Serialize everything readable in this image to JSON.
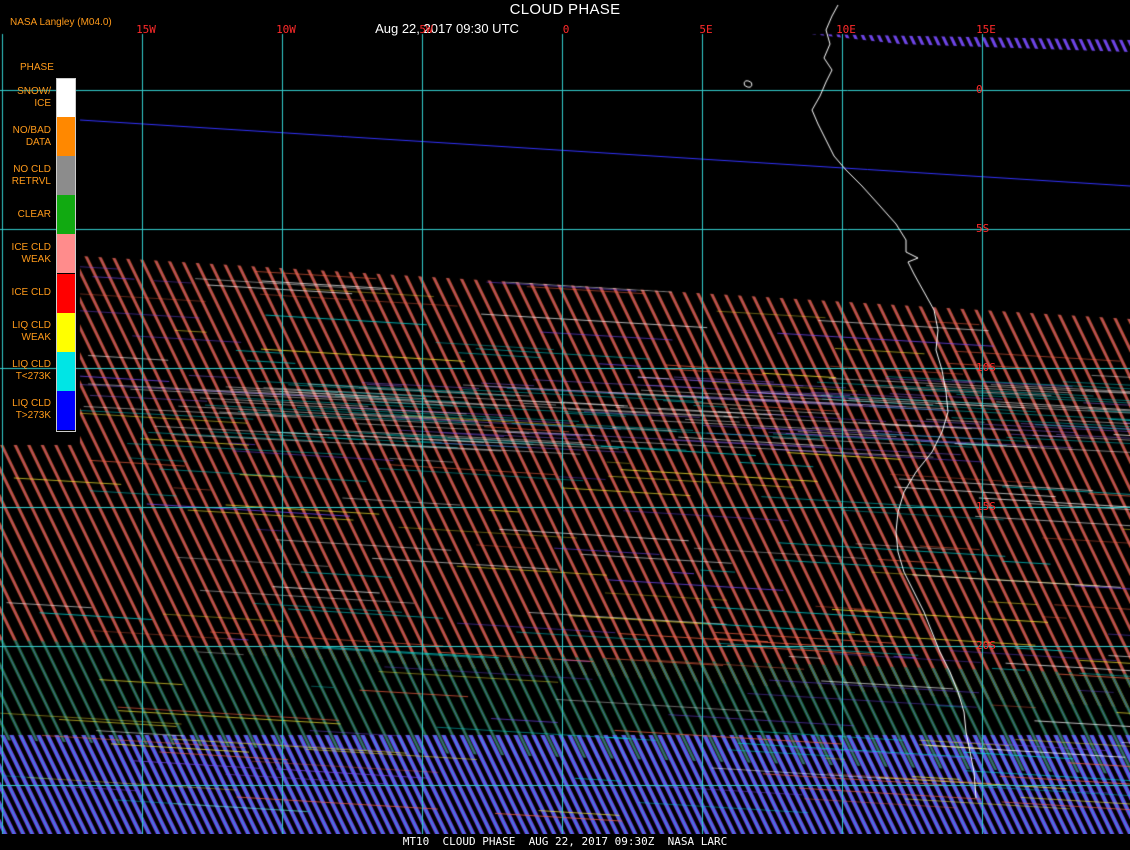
{
  "header": {
    "title": "CLOUD PHASE",
    "datetime": "Aug 22, 2017 09:30 UTC",
    "credit": "NASA Langley (M04.0)"
  },
  "grid": {
    "longitude_labels": [
      {
        "text": "15W",
        "lon": -15
      },
      {
        "text": "10W",
        "lon": -10
      },
      {
        "text": "5W",
        "lon": -5
      },
      {
        "text": "0",
        "lon": 0
      },
      {
        "text": "5E",
        "lon": 5
      },
      {
        "text": "10E",
        "lon": 10
      },
      {
        "text": "15E",
        "lon": 15
      }
    ],
    "latitude_labels": [
      {
        "text": "0",
        "lat": 0
      },
      {
        "text": "5S",
        "lat": -5
      },
      {
        "text": "10S",
        "lat": -10
      },
      {
        "text": "15S",
        "lat": -15
      },
      {
        "text": "20S",
        "lat": -20
      }
    ]
  },
  "legend": {
    "title": "PHASE",
    "items": [
      {
        "label": "SNOW/\nICE",
        "color": "#ffffff"
      },
      {
        "label": "NO/BAD\nDATA",
        "color": "#ff8800"
      },
      {
        "label": "NO CLD\nRETRVL",
        "color": "#8c8c8c"
      },
      {
        "label": "CLEAR",
        "color": "#11aa11"
      },
      {
        "label": "ICE CLD\nWEAK",
        "color": "#ff8c8c"
      },
      {
        "label": "ICE CLD",
        "color": "#ff0000"
      },
      {
        "label": "LIQ CLD\nWEAK",
        "color": "#ffff00"
      },
      {
        "label": "LIQ CLD\nT<273K",
        "color": "#00e5e5"
      },
      {
        "label": "LIQ CLD\nT>273K",
        "color": "#0000ff"
      }
    ]
  },
  "colors": {
    "grid": "#33cccc",
    "coastline": "#ffffff",
    "equator_track": "#3333ff",
    "ice_stripe": "#e8602c",
    "liquid_stripe": "#7a4cff",
    "clear_stripe": "#1f7a3a"
  },
  "footer": {
    "text": "MT10  CLOUD PHASE  AUG 22, 2017 09:30Z  NASA LARC"
  }
}
